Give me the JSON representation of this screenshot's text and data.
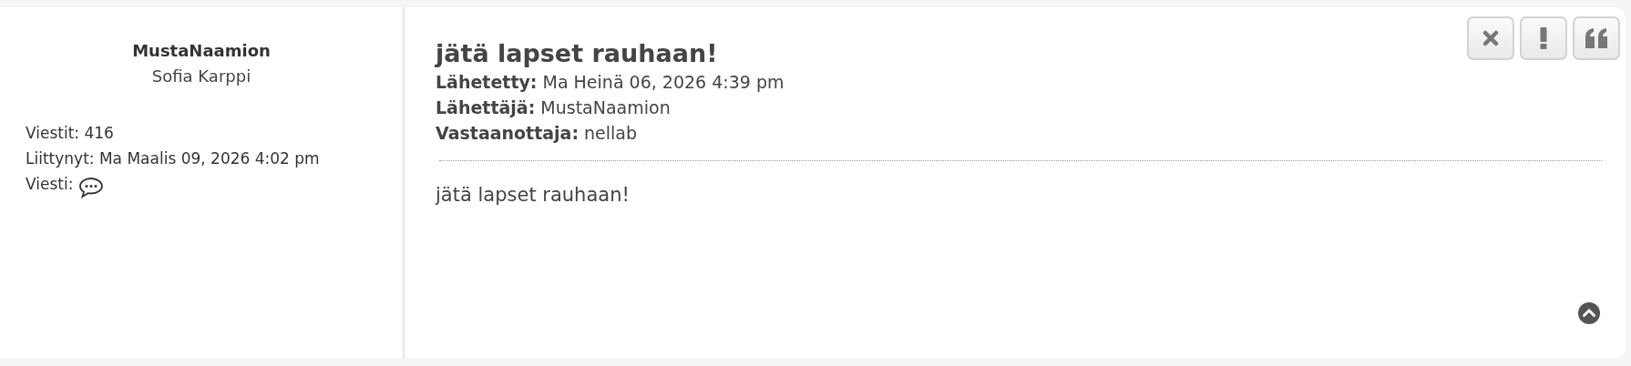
{
  "author": {
    "username": "MustaNaamion",
    "real_name": "Sofia Karppi",
    "stats": [
      {
        "kind": "text",
        "label": "Viestit:",
        "value": "416"
      },
      {
        "kind": "text",
        "label": "Liittynyt:",
        "value": "Ma Maalis 09, 2026 4:02 pm"
      },
      {
        "kind": "icon",
        "label": "Viesti:"
      }
    ]
  },
  "post": {
    "title": "jätä lapset rauhaan!",
    "meta": [
      {
        "label": "Lähetetty:",
        "value": "Ma Heinä 06, 2026 4:39 pm"
      },
      {
        "label": "Lähettäjä:",
        "value": "MustaNaamion"
      },
      {
        "label": "Vastaanottaja:",
        "value": "nellab"
      }
    ],
    "body": "jätä lapset rauhaan!",
    "actions": [
      {
        "kind": "delete"
      },
      {
        "kind": "report"
      },
      {
        "kind": "quote"
      }
    ]
  }
}
